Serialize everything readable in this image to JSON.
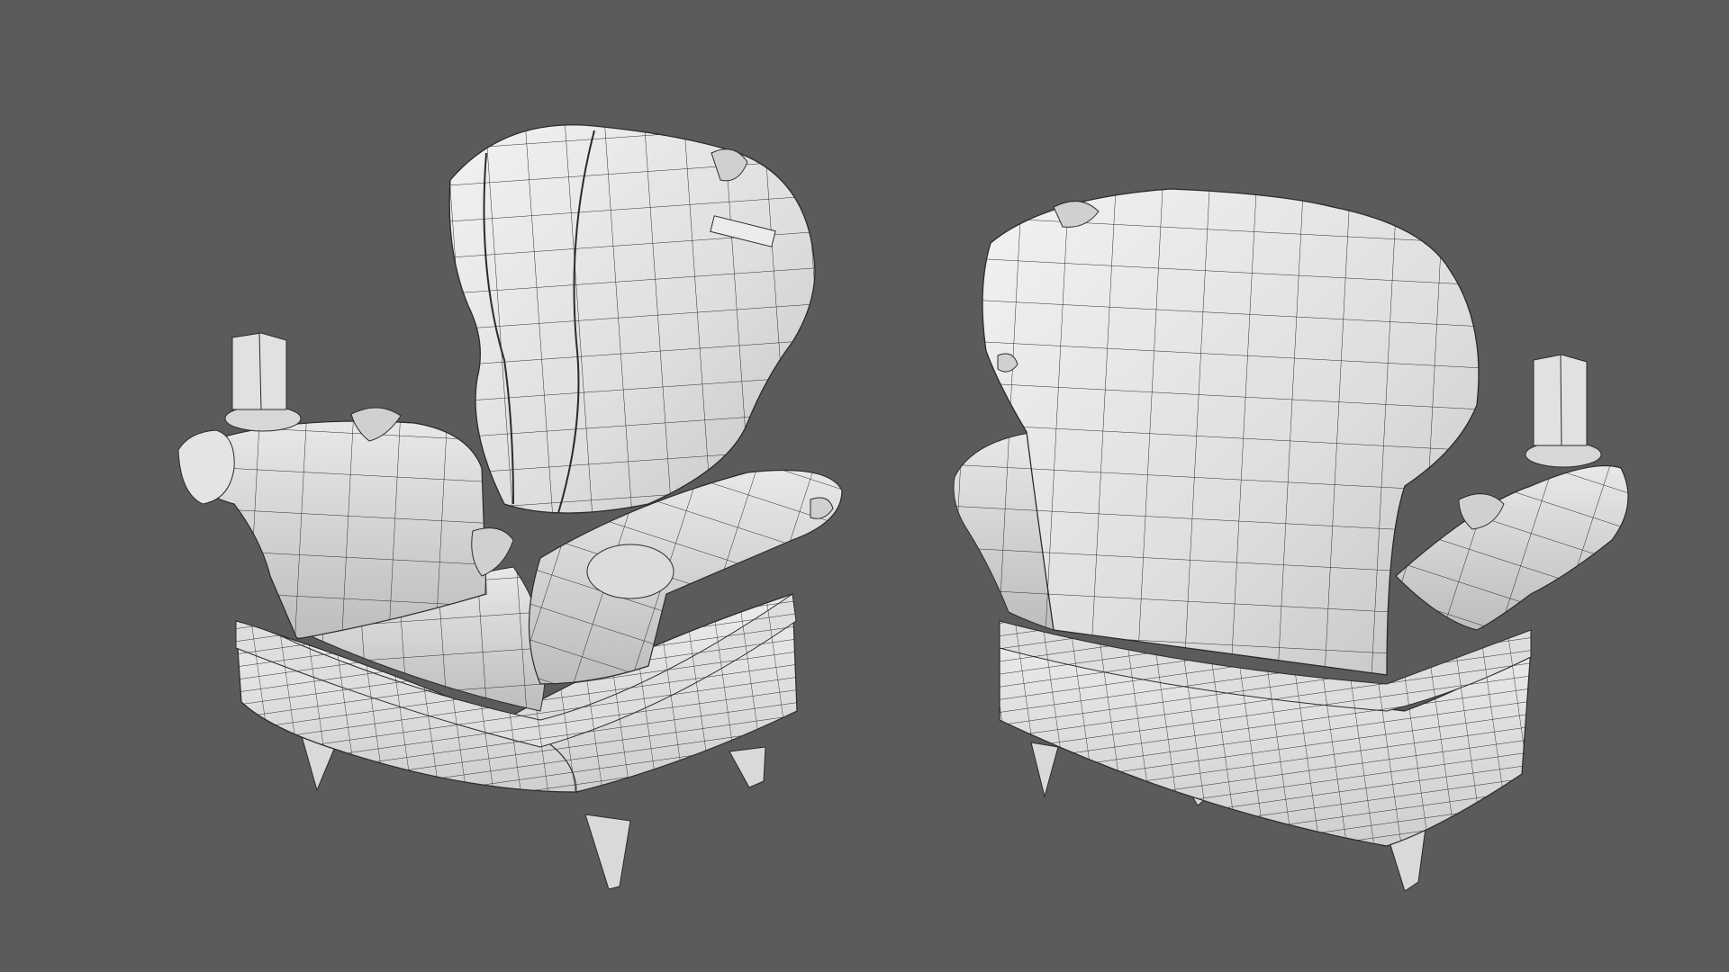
{
  "scene": {
    "background_color": "#5b5b5b",
    "surface_color": "#e6e6e6",
    "surface_shade_color": "#b9b9b9",
    "surface_dark_color": "#8f8f8f",
    "wire_color": "#2b2b2b",
    "objects": [
      {
        "name": "armchair-front-three-quarter-view",
        "kind": "wireframe-3d-model"
      },
      {
        "name": "armchair-back-three-quarter-view",
        "kind": "wireframe-3d-model"
      }
    ]
  }
}
